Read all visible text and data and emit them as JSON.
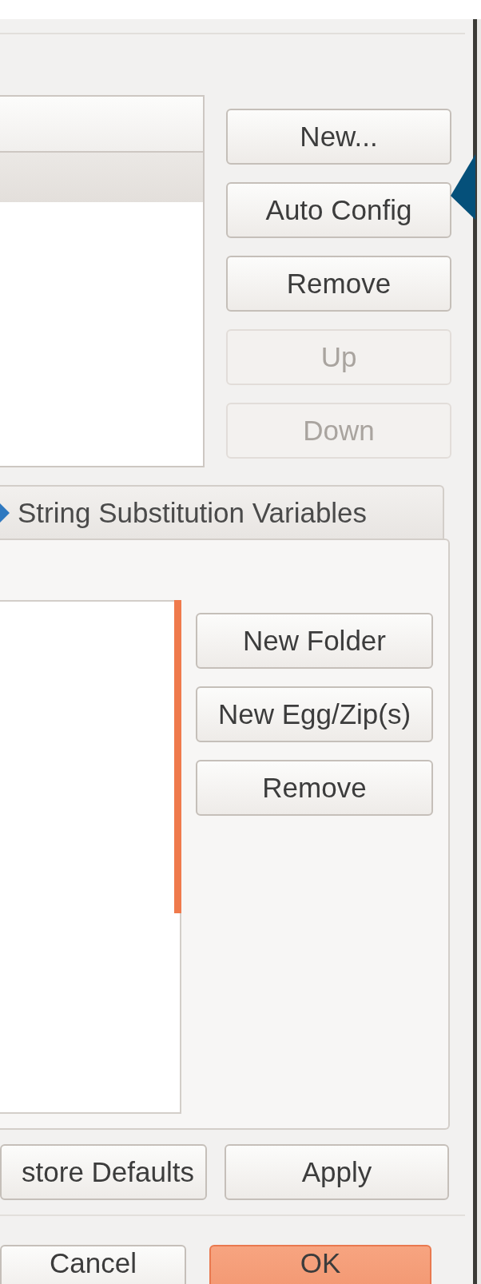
{
  "interpreter_table": {
    "rows": [
      {
        "selected": true
      }
    ]
  },
  "interpreter_buttons": [
    {
      "label": "New...",
      "disabled": false
    },
    {
      "label": "Auto Config",
      "disabled": false
    },
    {
      "label": "Remove",
      "disabled": false
    },
    {
      "label": "Up",
      "disabled": true
    },
    {
      "label": "Down",
      "disabled": true
    }
  ],
  "tabs": [
    {
      "label": "String Substitution Variables",
      "selected": false
    }
  ],
  "libraries_buttons": [
    {
      "label": "New Folder",
      "disabled": false
    },
    {
      "label": "New Egg/Zip(s)",
      "disabled": false
    },
    {
      "label": "Remove",
      "disabled": false
    }
  ],
  "page_buttons": [
    {
      "label": "store Defaults"
    },
    {
      "label": "Apply"
    }
  ],
  "dialog_buttons": [
    {
      "label": "Cancel",
      "default": false
    },
    {
      "label": "OK",
      "default": true
    }
  ]
}
